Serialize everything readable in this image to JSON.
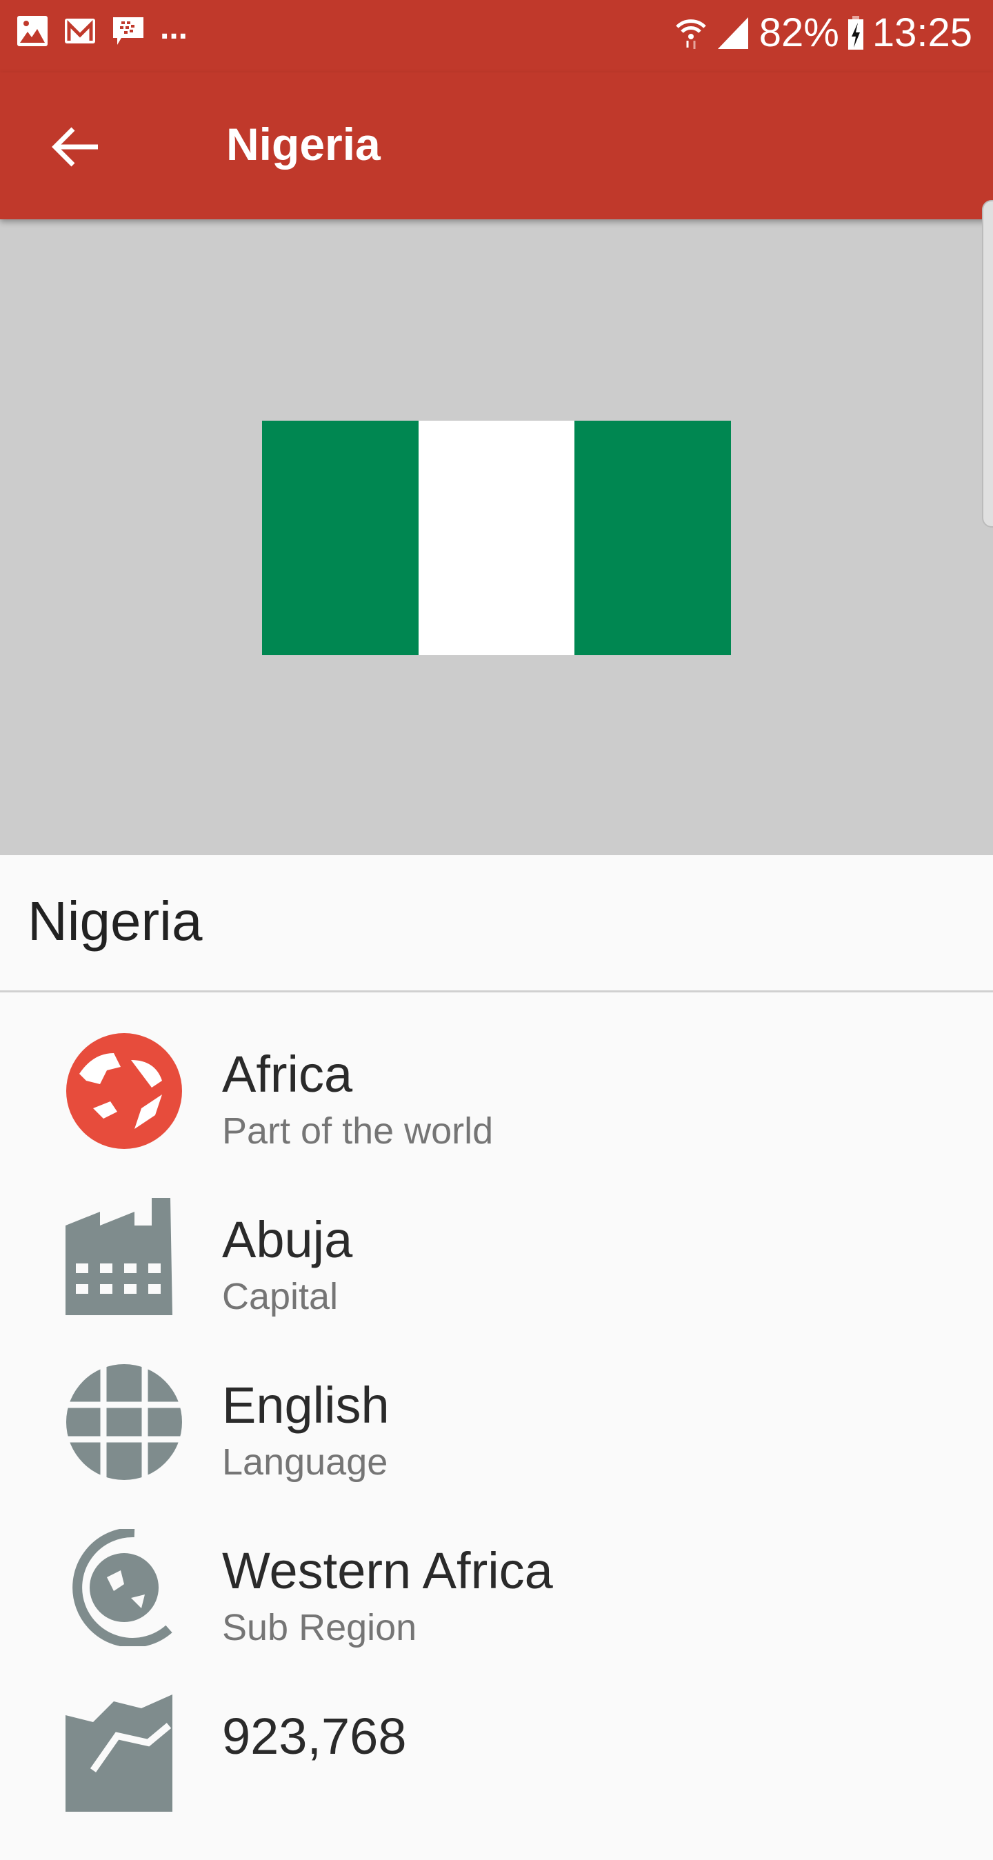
{
  "status_bar": {
    "battery": "82%",
    "time": "13:25",
    "notification_icons": [
      "gallery-icon",
      "gmail-icon",
      "bbm-icon"
    ],
    "more": "..."
  },
  "app_bar": {
    "title": "Nigeria"
  },
  "flag": {
    "colors": [
      "#008751",
      "#ffffff",
      "#008751"
    ]
  },
  "country_name": "Nigeria",
  "details": [
    {
      "title": "Africa",
      "subtitle": "Part of the world",
      "icon": "globe-icon",
      "color": "#e74c3c"
    },
    {
      "title": "Abuja",
      "subtitle": "Capital",
      "icon": "factory-icon",
      "color": "#7f8c8d"
    },
    {
      "title": "English",
      "subtitle": "Language",
      "icon": "language-globe-icon",
      "color": "#7f8c8d"
    },
    {
      "title": "Western Africa",
      "subtitle": "Sub Region",
      "icon": "region-icon",
      "color": "#7f8c8d"
    },
    {
      "title": "923,768",
      "subtitle": "",
      "icon": "area-chart-icon",
      "color": "#7f8c8d"
    }
  ]
}
